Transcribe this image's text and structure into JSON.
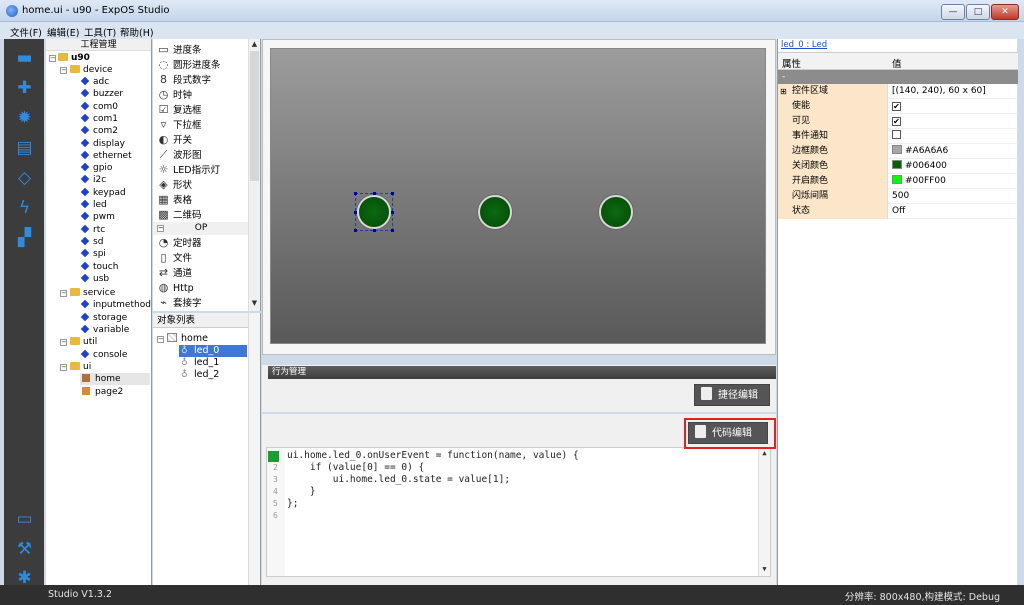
{
  "window": {
    "title": "home.ui - u90 - ExpOS Studio",
    "btn_min": "—",
    "btn_max": "□",
    "btn_close": "✕"
  },
  "menubar": {
    "items": [
      "文件(F)",
      "编辑(E)",
      "工具(T)",
      "帮助(H)"
    ]
  },
  "toolbar": {
    "icons": [
      "folder-open-icon",
      "add-icon",
      "settings-gear-icon",
      "document-icon",
      "gem-icon",
      "lightning-icon",
      "network-icon"
    ],
    "bottom_icons": [
      "monitor-icon",
      "hammer-icon",
      "bug-icon"
    ]
  },
  "project": {
    "title": "工程管理",
    "root": "u90",
    "device_folder": "device",
    "device_items": [
      "adc",
      "buzzer",
      "com0",
      "com1",
      "com2",
      "display",
      "ethernet",
      "gpio",
      "i2c",
      "keypad",
      "led",
      "pwm",
      "rtc",
      "sd",
      "spi",
      "touch",
      "usb"
    ],
    "service_folder": "service",
    "service_items": [
      "inputmethod",
      "storage",
      "variable"
    ],
    "util_folder": "util",
    "util_items": [
      "console"
    ],
    "ui_folder": "ui",
    "ui_items": [
      "home",
      "page2"
    ],
    "selected_ui": "home"
  },
  "widgets": {
    "items": [
      {
        "icon": "progress-bar-icon",
        "label": "进度条"
      },
      {
        "icon": "circular-progress-icon",
        "label": "圆形进度条"
      },
      {
        "icon": "segment-digit-icon",
        "label": "段式数字"
      },
      {
        "icon": "clock-icon",
        "label": "时钟"
      },
      {
        "icon": "checkbox-icon",
        "label": "复选框"
      },
      {
        "icon": "dropdown-icon",
        "label": "下拉框"
      },
      {
        "icon": "switch-icon",
        "label": "开关"
      },
      {
        "icon": "waveform-icon",
        "label": "波形图"
      },
      {
        "icon": "led-icon",
        "label": "LED指示灯"
      },
      {
        "icon": "shape-icon",
        "label": "形状"
      },
      {
        "icon": "table-icon",
        "label": "表格"
      },
      {
        "icon": "qrcode-icon",
        "label": "二维码"
      }
    ],
    "op_header": "OP",
    "op_items": [
      {
        "icon": "timer-icon",
        "label": "定时器"
      },
      {
        "icon": "file-icon",
        "label": "文件"
      },
      {
        "icon": "channel-icon",
        "label": "通道"
      },
      {
        "icon": "globe-icon",
        "label": "Http"
      },
      {
        "icon": "socket-icon",
        "label": "套接字"
      }
    ]
  },
  "objects": {
    "title": "对象列表",
    "root": "home",
    "items": [
      "led_0",
      "led_1",
      "led_2"
    ],
    "selected": "led_0"
  },
  "canvas": {
    "leds": [
      {
        "name": "led_0",
        "state": "off",
        "color": "#006400"
      },
      {
        "name": "led_1",
        "state": "off",
        "color": "#006400"
      },
      {
        "name": "led_2",
        "state": "off",
        "color": "#006400"
      }
    ],
    "selected": "led_0"
  },
  "behavior": {
    "header": "行为管理",
    "shortcut_button": "捷径编辑",
    "code_button": "代码编辑"
  },
  "code": {
    "lines": [
      {
        "n": "1",
        "text": "ui.home.led_0.onUserEvent = function(name, value) {"
      },
      {
        "n": "2",
        "text": "    if (value[0] == 0) {"
      },
      {
        "n": "3",
        "text": "        ui.home.led_0.state = value[1];"
      },
      {
        "n": "4",
        "text": "    }"
      },
      {
        "n": "5",
        "text": "};"
      },
      {
        "n": "6",
        "text": ""
      }
    ]
  },
  "properties": {
    "object_link": "led_0 : Led",
    "col_name": "属性",
    "col_value": "值",
    "category": "-",
    "rows": [
      {
        "name": "控件区域",
        "value": "[(140, 240), 60 x 60]",
        "expandable": true
      },
      {
        "name": "使能",
        "value": "✔",
        "kind": "check"
      },
      {
        "name": "可见",
        "value": "✔",
        "kind": "check"
      },
      {
        "name": "事件通知",
        "value": "",
        "kind": "check"
      },
      {
        "name": "边框颜色",
        "value": "#A6A6A6",
        "kind": "color",
        "color": "#A6A6A6"
      },
      {
        "name": "关闭颜色",
        "value": "#006400",
        "kind": "color",
        "color": "#006400"
      },
      {
        "name": "开启颜色",
        "value": "#00FF00",
        "kind": "color",
        "color": "#00FF00"
      },
      {
        "name": "闪烁间隔",
        "value": "500"
      },
      {
        "name": "状态",
        "value": "Off"
      }
    ]
  },
  "status": {
    "version": "Studio V1.3.2",
    "right": "分辨率: 800x480,构建模式: Debug"
  }
}
